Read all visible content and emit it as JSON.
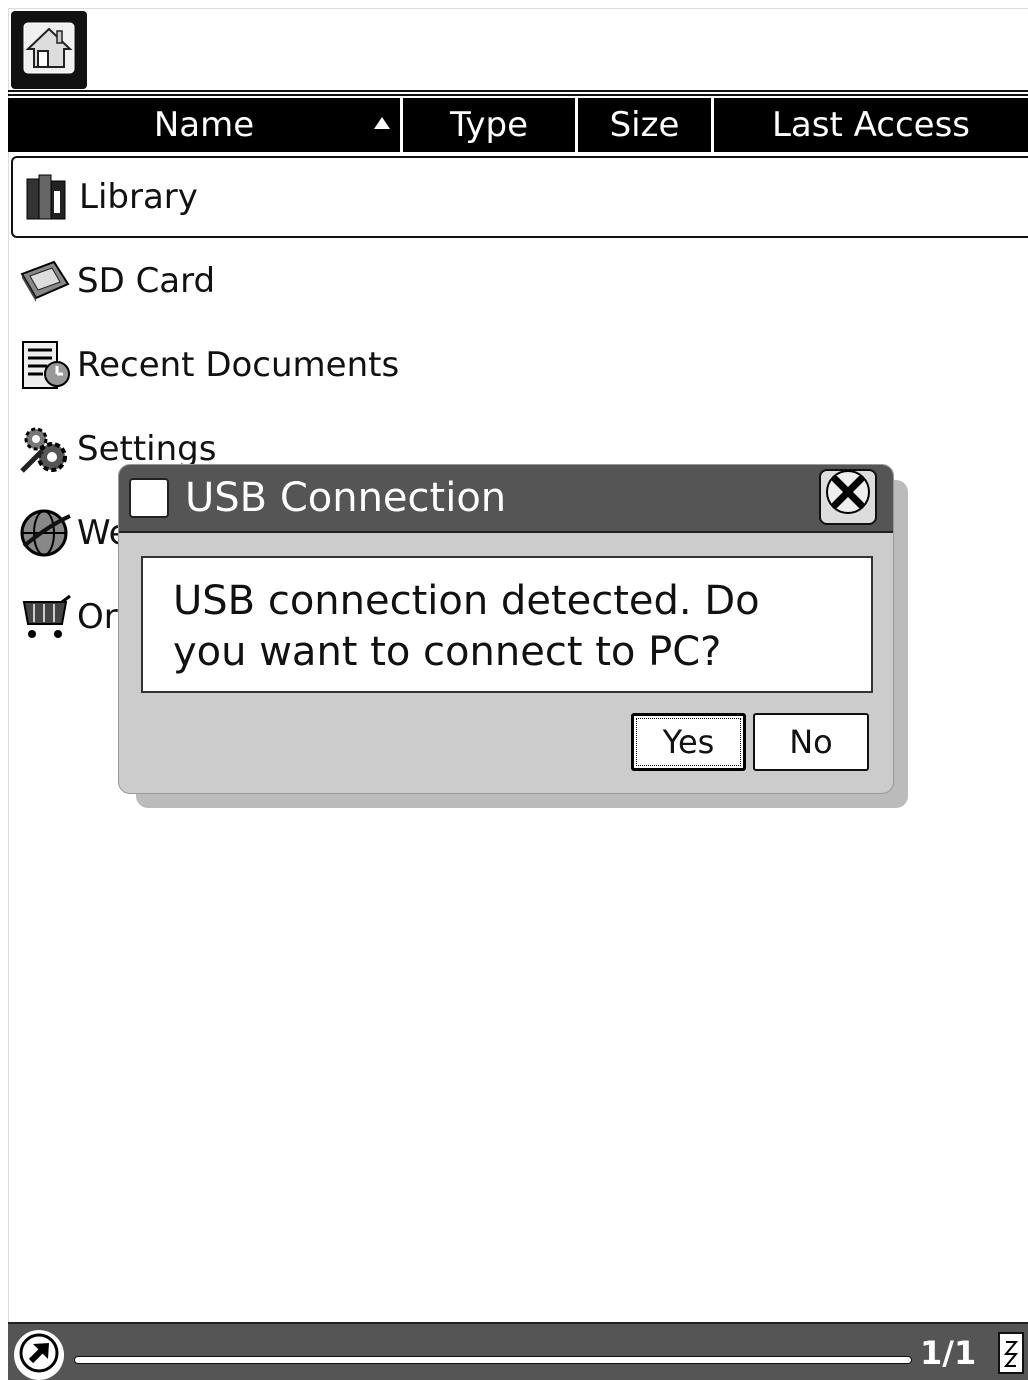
{
  "toolbar": {
    "home_icon": "home-icon"
  },
  "columns": [
    {
      "label": "Name",
      "sort": "ascending"
    },
    {
      "label": "Type"
    },
    {
      "label": "Size"
    },
    {
      "label": "Last Access"
    }
  ],
  "items": [
    {
      "label": "Library",
      "icon": "library-books-icon",
      "selected": true
    },
    {
      "label": "SD Card",
      "icon": "sd-card-icon"
    },
    {
      "label": "Recent Documents",
      "icon": "recent-documents-icon"
    },
    {
      "label": "Settings",
      "icon": "settings-gears-icon"
    },
    {
      "label": "We",
      "icon": "globe-icon"
    },
    {
      "label": "Or",
      "icon": "shopping-cart-icon"
    }
  ],
  "dialog": {
    "title": "USB Connection",
    "message_line1": "USB connection detected. Do",
    "message_line2": "you want to connect to PC?",
    "yes_label": "Yes",
    "no_label": "No"
  },
  "status": {
    "page": "1/1",
    "progress": 1.0
  }
}
